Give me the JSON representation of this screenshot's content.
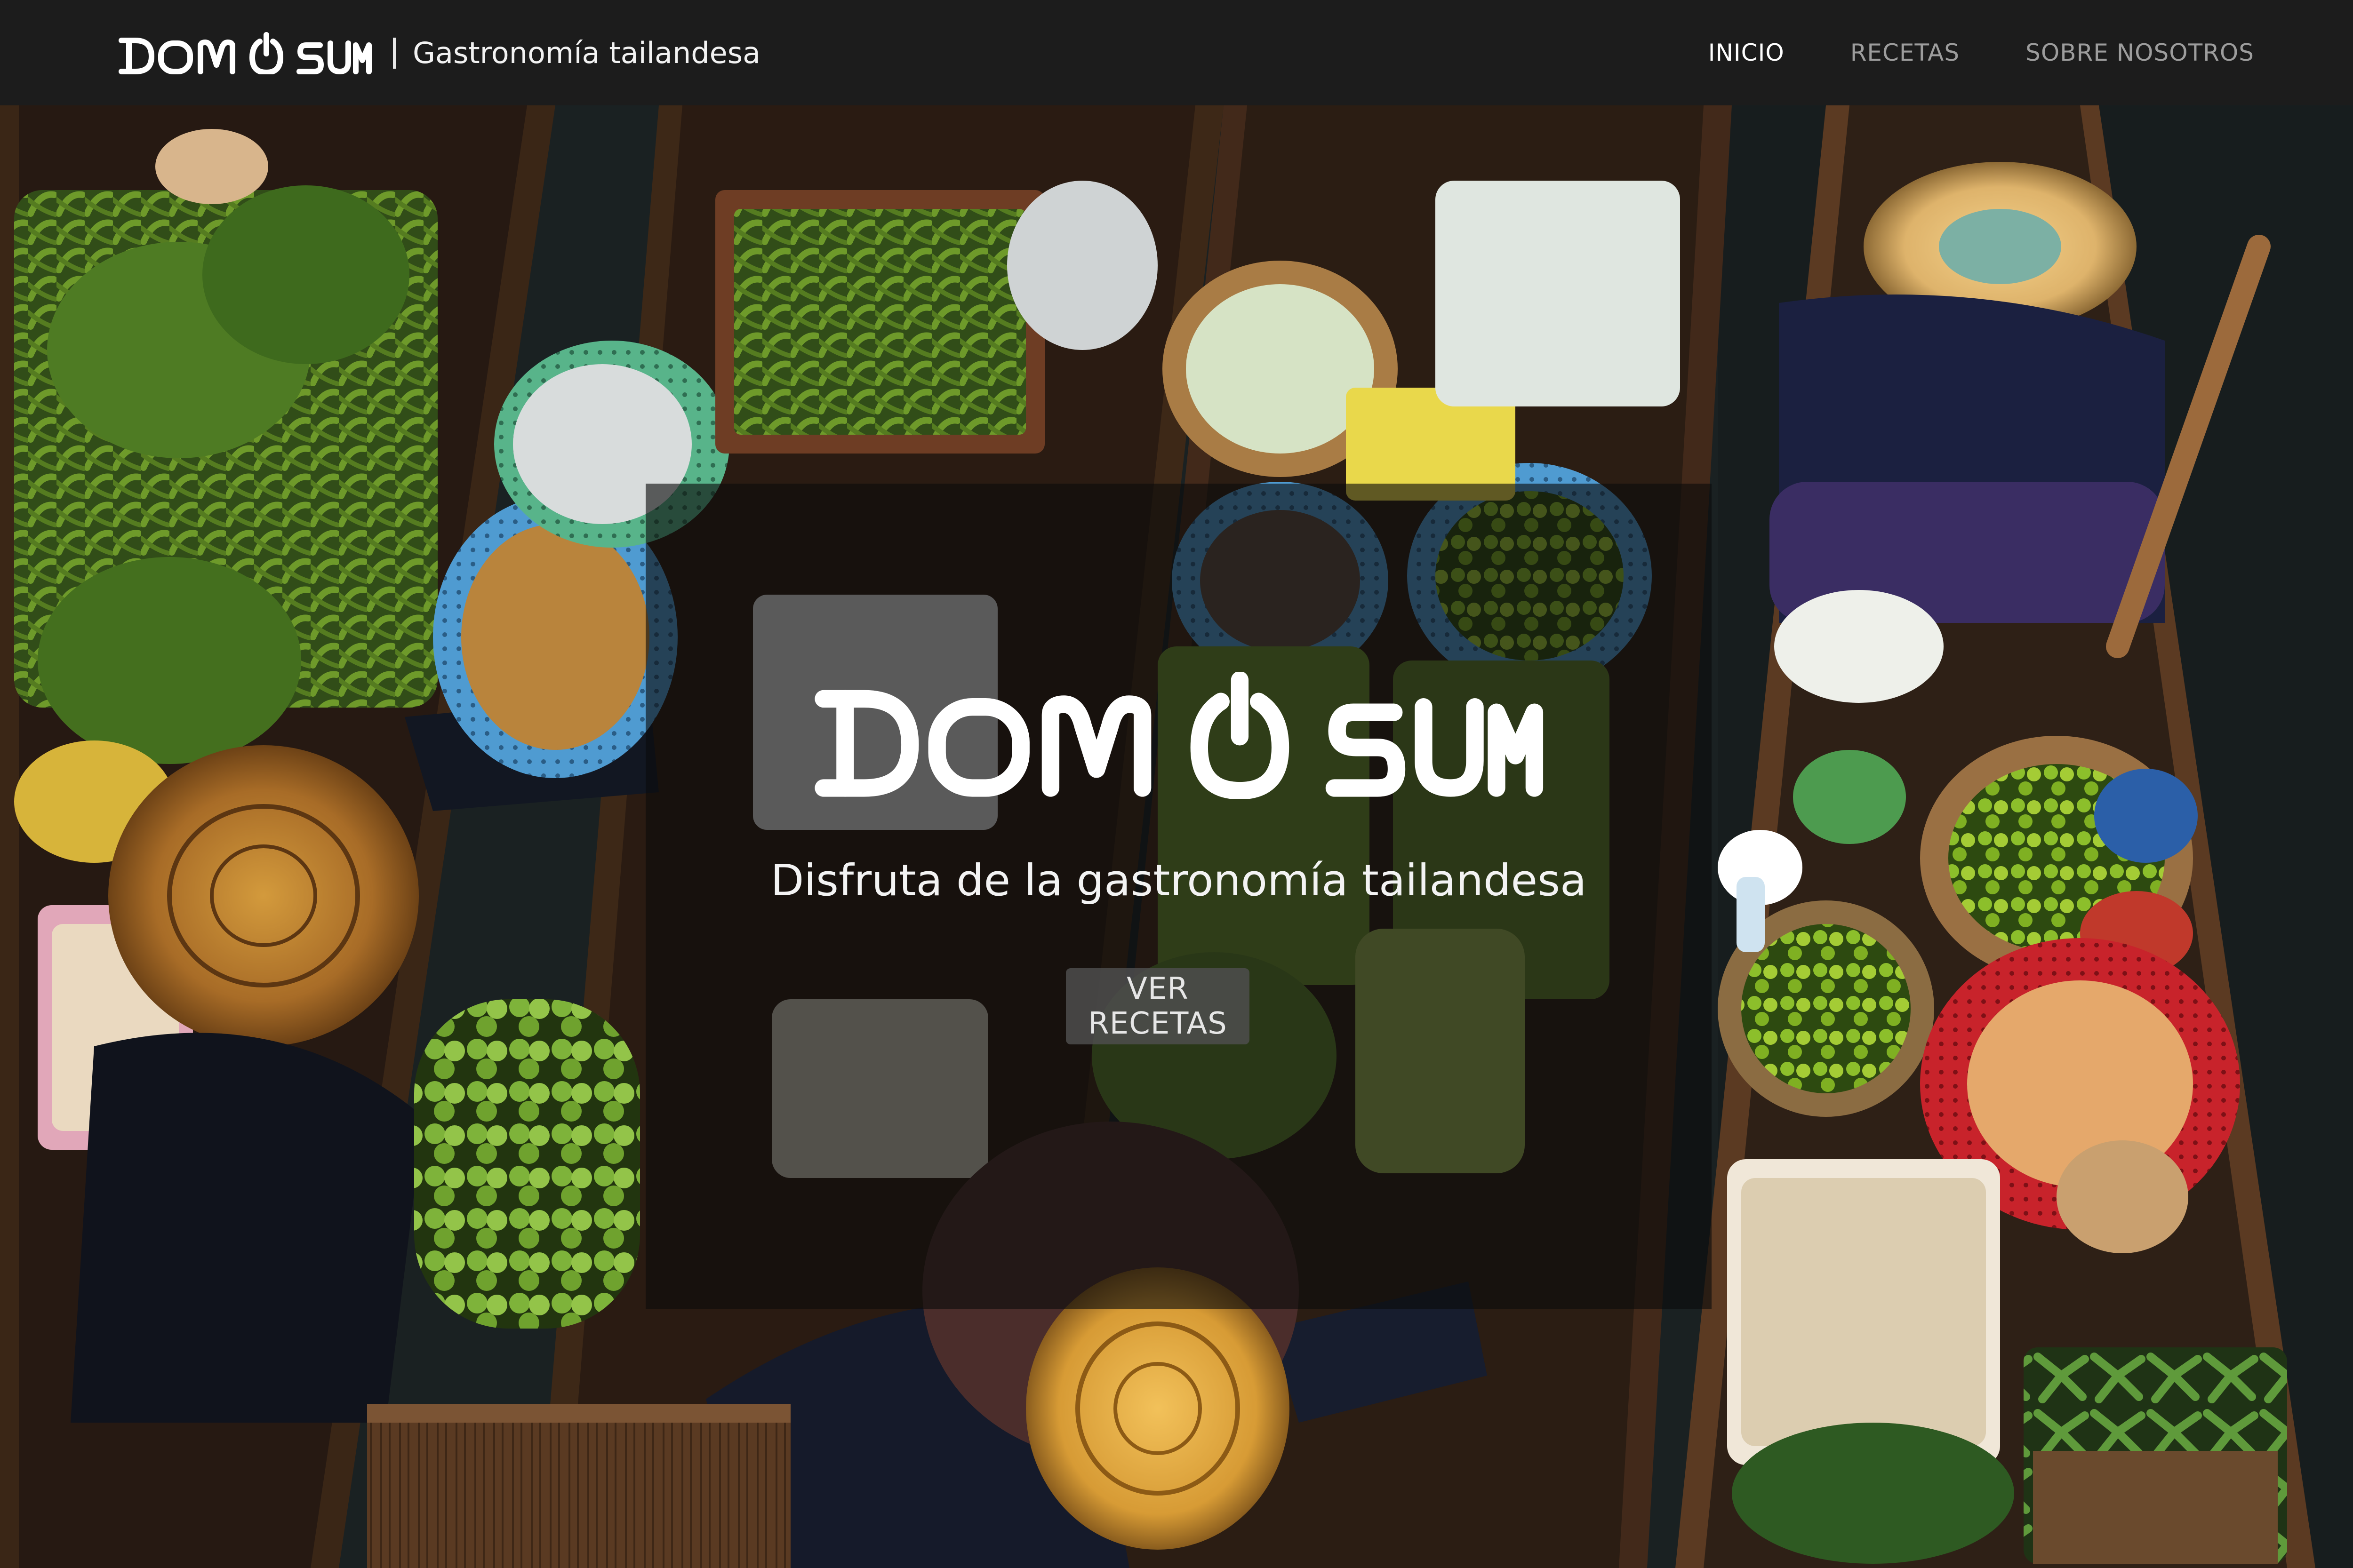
{
  "brand": {
    "name": "DOM SUM",
    "tagline": "Gastronomía tailandesa"
  },
  "nav": {
    "items": [
      {
        "label": "INICIO",
        "active": true
      },
      {
        "label": "RECETAS",
        "active": false
      },
      {
        "label": "SOBRE NOSOTROS",
        "active": false
      }
    ]
  },
  "hero": {
    "logo_text": "DOM SUM",
    "subtitle": "Disfruta de la gastronomía tailandesa",
    "button_label": "VER RECETAS",
    "image_description_icon": "floating-market-photo"
  },
  "colors": {
    "navbar_bg": "#1c1c1c",
    "nav_active": "#ffffff",
    "nav_inactive": "#9d9d9d",
    "overlay": "rgba(12,12,12,0.62)",
    "button_bg": "#4e4e4e"
  }
}
